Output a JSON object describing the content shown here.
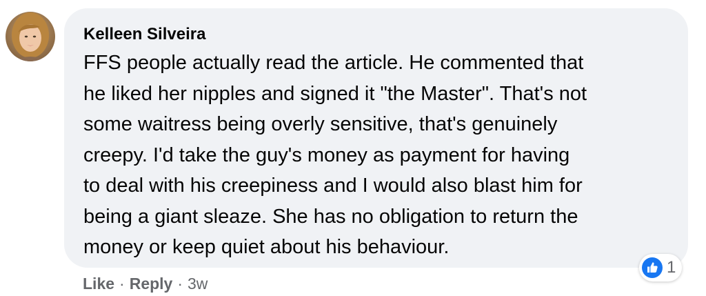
{
  "comment": {
    "author": "Kelleen Silveira",
    "lines": [
      "FFS people actually read the article. He commented that",
      "he liked her nipples and signed it \"the Master\". That's not",
      "some waitress being overly sensitive, that's genuinely",
      "creepy. I'd take the guy's money as payment for having",
      "to deal with his creepiness and I would also blast him for",
      "being a giant sleaze. She has no obligation to return the",
      "money or keep quiet about his behaviour."
    ]
  },
  "reactions": {
    "icon": "like-icon",
    "count": "1",
    "color": "#1877f2"
  },
  "actions": {
    "like_label": "Like",
    "separator": "·",
    "reply_label": "Reply",
    "timestamp": "3w"
  },
  "colors": {
    "bubble_bg": "#f0f2f5",
    "text": "#050505",
    "secondary_text": "#65676b"
  }
}
